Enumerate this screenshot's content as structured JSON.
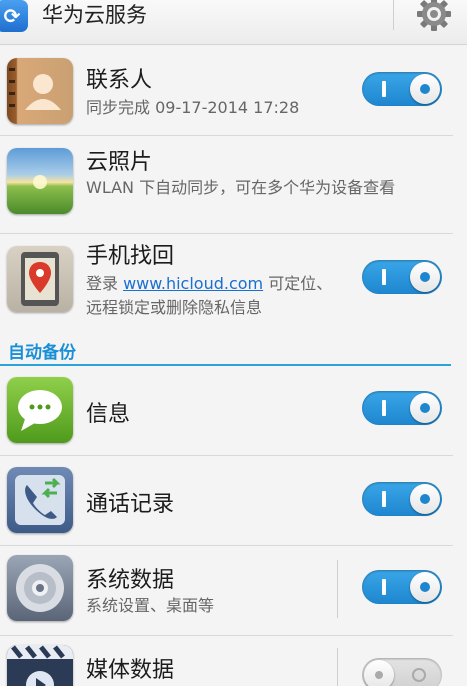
{
  "app": {
    "title": "华为云服务"
  },
  "items": [
    {
      "title": "联系人",
      "subtitle": "同步完成  09-17-2014 17:28",
      "toggle": "on"
    },
    {
      "title": "云照片",
      "subtitle": "WLAN 下自动同步，可在多个华为设备查看"
    },
    {
      "title": "手机找回",
      "subtitle_prefix": "登录 ",
      "link": "www.hicloud.com",
      "subtitle_suffix": " 可定位、远程锁定或删除隐私信息",
      "toggle": "on"
    }
  ],
  "section": {
    "label": "自动备份"
  },
  "backup_items": [
    {
      "title": "信息",
      "toggle": "on"
    },
    {
      "title": "通话记录",
      "toggle": "on"
    },
    {
      "title": "系统数据",
      "subtitle": "系统设置、桌面等",
      "toggle": "on"
    },
    {
      "title": "媒体数据",
      "toggle": "off"
    }
  ],
  "colors": {
    "accent": "#1e86cf",
    "section_text": "#1a8fd6",
    "link": "#1a6fd0"
  },
  "icons": [
    "sync-icon",
    "gear-icon",
    "contacts-book-icon",
    "cloud-photo-icon",
    "phone-finder-icon",
    "message-bubble-icon",
    "call-log-icon",
    "system-data-gear-icon",
    "media-clapper-icon"
  ]
}
